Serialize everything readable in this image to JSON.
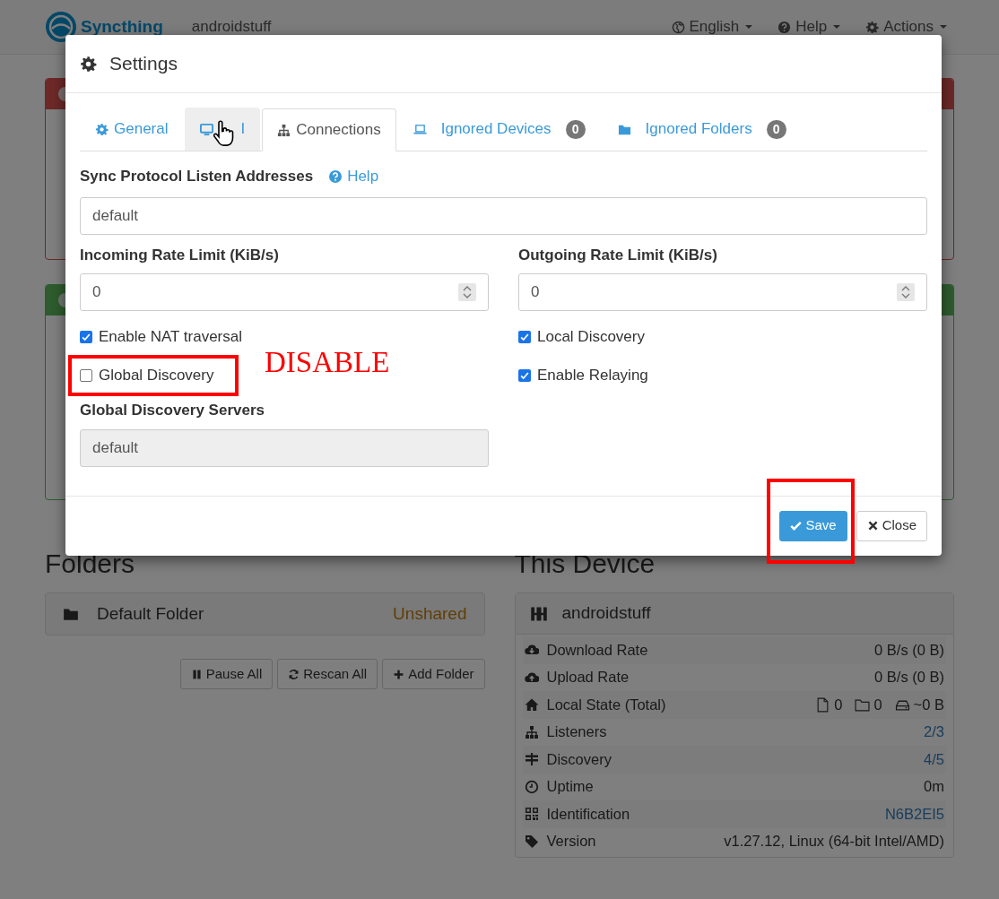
{
  "navbar": {
    "brand": "Syncthing",
    "device_name": "androidstuff",
    "menus": [
      {
        "label": "English"
      },
      {
        "label": "Help"
      },
      {
        "label": "Actions"
      }
    ]
  },
  "alerts": [
    {
      "kind": "danger"
    },
    {
      "kind": "success"
    }
  ],
  "folders": {
    "heading": "Folders",
    "items": [
      {
        "name": "Default Folder",
        "status": "Unshared"
      }
    ],
    "buttons": [
      {
        "label": "Pause All"
      },
      {
        "label": "Rescan All"
      },
      {
        "label": "Add Folder"
      }
    ]
  },
  "this_device": {
    "heading": "This Device",
    "name": "androidstuff",
    "rows": [
      {
        "label": "Download Rate",
        "kind": "text",
        "value": "0 B/s (0 B)"
      },
      {
        "label": "Upload Rate",
        "kind": "text",
        "value": "0 B/s (0 B)"
      },
      {
        "label": "Local State (Total)",
        "kind": "counts",
        "files": "0",
        "folders": "0",
        "size": "~0 B"
      },
      {
        "label": "Listeners",
        "kind": "link",
        "value": "2/3"
      },
      {
        "label": "Discovery",
        "kind": "link",
        "value": "4/5"
      },
      {
        "label": "Uptime",
        "kind": "text",
        "value": "0m"
      },
      {
        "label": "Identification",
        "kind": "link",
        "value": "N6B2EI5"
      },
      {
        "label": "Version",
        "kind": "text",
        "value": "v1.27.12, Linux (64-bit Intel/AMD)"
      }
    ]
  },
  "settings_dialog": {
    "title": "Settings",
    "tabs": [
      {
        "label": "General",
        "selected": false,
        "hovered": false
      },
      {
        "label": "I",
        "selected": false,
        "hovered": true
      },
      {
        "label": "Connections",
        "selected": true,
        "hovered": false
      },
      {
        "label": "Ignored Devices",
        "selected": false,
        "hovered": false,
        "badge": "0"
      },
      {
        "label": "Ignored Folders",
        "selected": false,
        "hovered": false,
        "badge": "0"
      }
    ],
    "listen_addresses": {
      "label": "Sync Protocol Listen Addresses",
      "help": "Help",
      "value": "default"
    },
    "incoming_rate": {
      "label": "Incoming Rate Limit (KiB/s)",
      "value": "0"
    },
    "outgoing_rate": {
      "label": "Outgoing Rate Limit (KiB/s)",
      "value": "0"
    },
    "left_checkboxes": [
      {
        "label": "Enable NAT traversal",
        "checked": true,
        "highlighted": false
      },
      {
        "label": "Global Discovery",
        "checked": false,
        "highlighted": true
      }
    ],
    "right_checkboxes": [
      {
        "label": "Local Discovery",
        "checked": true,
        "highlighted": false
      },
      {
        "label": "Enable Relaying",
        "checked": true,
        "highlighted": false
      }
    ],
    "discovery_servers": {
      "label": "Global Discovery Servers",
      "value": "default",
      "disabled": true
    },
    "buttons": [
      {
        "label": "Save",
        "kind": "primary",
        "highlighted": true
      },
      {
        "label": "Close",
        "kind": "default",
        "highlighted": false
      }
    ]
  },
  "annotation": {
    "text": "DISABLE"
  }
}
